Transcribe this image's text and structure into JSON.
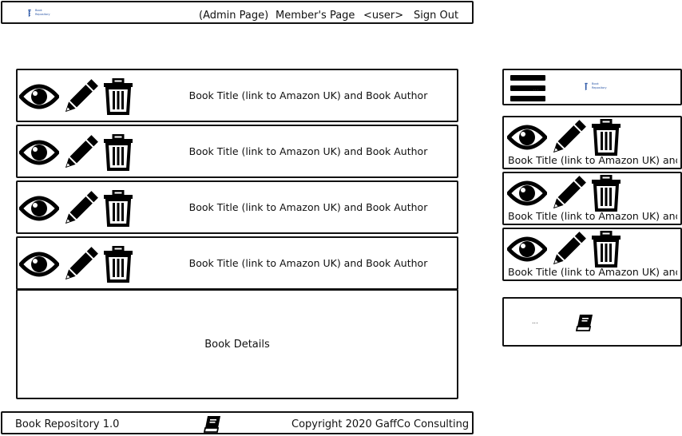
{
  "header": {
    "logo_text": "Book Repository",
    "nav": [
      {
        "label": "(Admin Page)"
      },
      {
        "label": "Member's Page"
      },
      {
        "label": "<user>"
      },
      {
        "label": "Sign Out"
      }
    ]
  },
  "books": [
    {
      "title_author": "Book Title (link to Amazon UK) and Book Author"
    },
    {
      "title_author": "Book Title (link to Amazon UK) and Book Author"
    },
    {
      "title_author": "Book Title (link to Amazon UK) and Book Author"
    },
    {
      "title_author": "Book Title (link to Amazon UK) and Book Author"
    }
  ],
  "details": {
    "label": "Book Details"
  },
  "mobile": {
    "header": {
      "ellipsis": "...",
      "logo_text": "Book Repository"
    },
    "books": [
      {
        "title_author": "Book Title (link to Amazon UK) and"
      },
      {
        "title_author": "Book Title (link to Amazon UK) and"
      },
      {
        "title_author": "Book Title (link to Amazon UK) and"
      }
    ],
    "footer": {
      "ellipsis": "..."
    }
  },
  "footer": {
    "app_version": "Book Repository 1.0",
    "copyright": "Copyright 2020 GaffCo Consulting"
  },
  "icons": [
    "eye-icon",
    "pencil-icon",
    "trash-icon",
    "book-icon",
    "hamburger-icon"
  ]
}
